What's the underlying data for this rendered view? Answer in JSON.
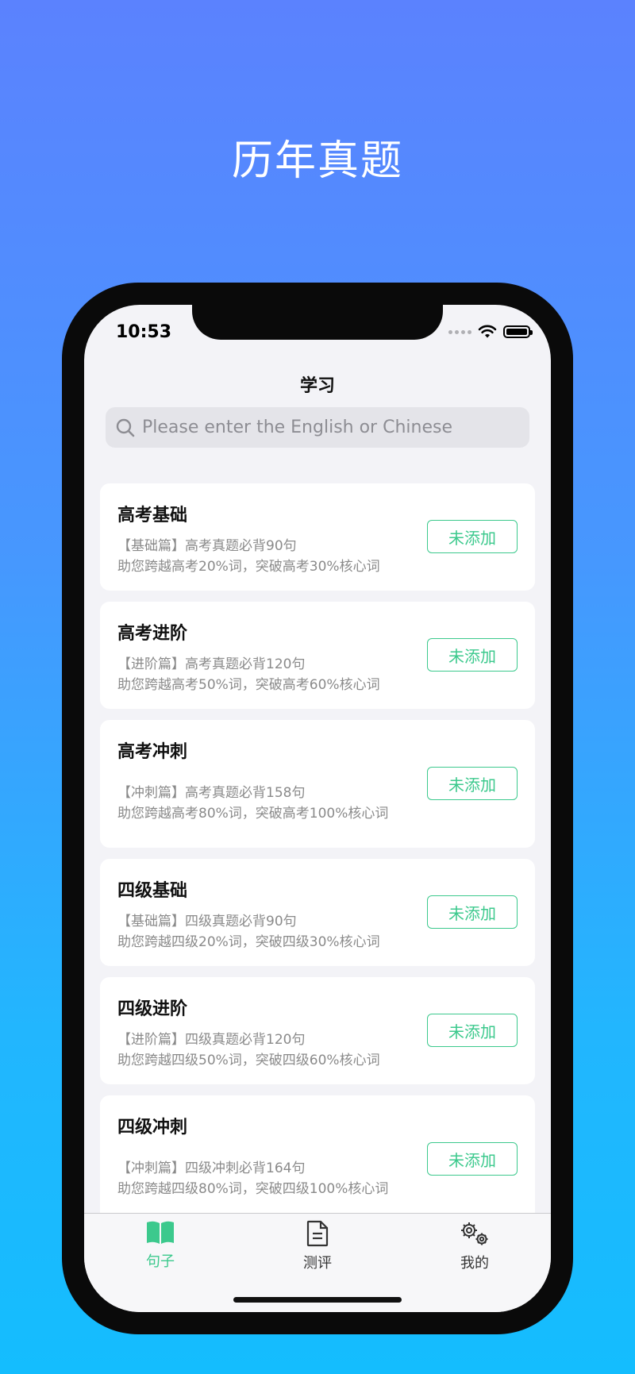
{
  "promo": {
    "headline": "历年真题"
  },
  "status_bar": {
    "time": "10:53"
  },
  "nav": {
    "title": "学习"
  },
  "search": {
    "placeholder": "Please enter the English or Chinese"
  },
  "cards": [
    {
      "title": "高考基础",
      "line1": "【基础篇】高考真题必背90句",
      "line2": "助您跨越高考20%词，突破高考30%核心词",
      "button": "未添加"
    },
    {
      "title": "高考进阶",
      "line1": "【进阶篇】高考真题必背120句",
      "line2": "助您跨越高考50%词，突破高考60%核心词",
      "button": "未添加"
    },
    {
      "title": "高考冲刺",
      "line1": "【冲刺篇】高考真题必背158句",
      "line2": "助您跨越高考80%词，突破高考100%核心词",
      "button": "未添加"
    },
    {
      "title": "四级基础",
      "line1": "【基础篇】四级真题必背90句",
      "line2": "助您跨越四级20%词，突破四级30%核心词",
      "button": "未添加"
    },
    {
      "title": "四级进阶",
      "line1": "【进阶篇】四级真题必背120句",
      "line2": "助您跨越四级50%词，突破四级60%核心词",
      "button": "未添加"
    },
    {
      "title": "四级冲刺",
      "line1": "【冲刺篇】四级冲刺必背164句",
      "line2": "助您跨越四级80%词，突破四级100%核心词",
      "button": "未添加"
    }
  ],
  "tabs": [
    {
      "label": "句子",
      "icon": "book-icon",
      "active": true
    },
    {
      "label": "测评",
      "icon": "document-icon",
      "active": false
    },
    {
      "label": "我的",
      "icon": "gears-icon",
      "active": false
    }
  ],
  "colors": {
    "accent": "#3cc98d",
    "inactive_tab": "#333333"
  }
}
